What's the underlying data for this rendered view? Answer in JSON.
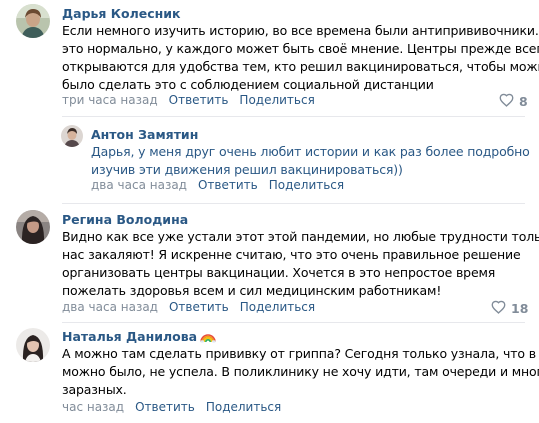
{
  "comments": [
    {
      "author": "Дарья Колесник",
      "lines": [
        "Если немного изучить историю, во все времена были антипрививочники. И",
        "это нормально, у каждого может быть своё мнение. Центры прежде всего",
        "открываются для удобства тем, кто решил вакцинироваться, чтобы можно",
        "было сделать это с соблюдением социальной дистанции"
      ],
      "time": "три часа назад",
      "reply_label": "Ответить",
      "share_label": "Поделиться",
      "likes": "8"
    },
    {
      "author": "Антон Замятин",
      "addressee": "Дарья",
      "lines": [
        ", у меня друг очень любит истории и как раз более подробно",
        "изучив эти движения решил вакцинироваться))"
      ],
      "time": "два часа назад",
      "reply_label": "Ответить",
      "share_label": "Поделиться"
    },
    {
      "author": "Регина Володина",
      "lines": [
        "Видно как все уже устали этот этой пандемии, но любые трудности только",
        "нас закаляют! Я искренне считаю, что это очень правильное решение",
        "организовать центры вакцинации. Хочется в это непростое время",
        "пожелать здоровья всем и сил медицинским работникам!"
      ],
      "time": "два часа назад",
      "reply_label": "Ответить",
      "share_label": "Поделиться",
      "likes": "18"
    },
    {
      "author": "Наталья Данилова",
      "lines": [
        "А можно там сделать прививку от гриппа? Сегодня только узнала, что в ТЦ",
        "можно было, не успела. В поликлинику не хочу идти, там очереди и много",
        "заразных."
      ],
      "time": "час назад",
      "reply_label": "Ответить",
      "share_label": "Поделиться"
    }
  ],
  "colors": {
    "link": "#2a5885",
    "meta": "#818c99",
    "divider": "#e7e8ec"
  },
  "icons": {
    "like": "heart-icon",
    "author_badge": "rainbow-emoji-icon"
  }
}
